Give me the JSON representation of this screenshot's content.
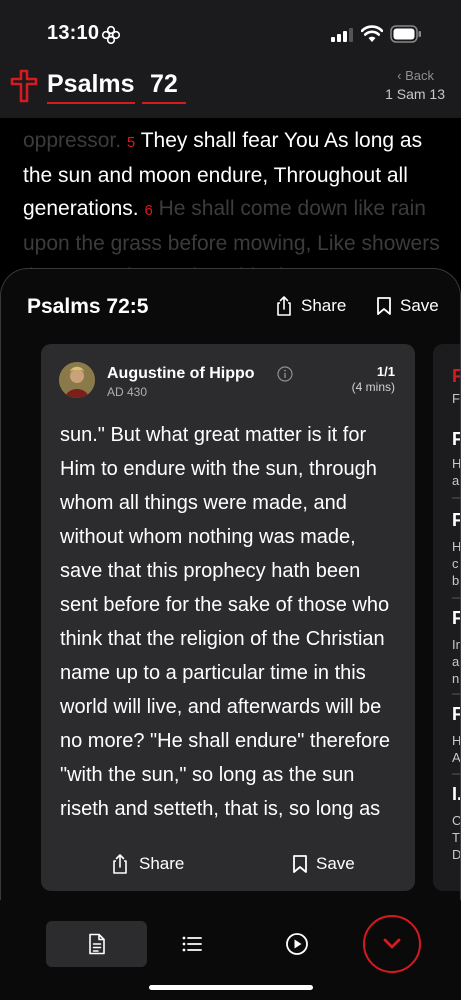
{
  "status": {
    "time": "13:10"
  },
  "header": {
    "book": "Psalms",
    "chapter": "72",
    "back_label": "Back",
    "back_ref": "1 Sam 13"
  },
  "scripture": {
    "pre": "oppressor.",
    "v5_num": "5",
    "v5_text": "They shall fear You As long as the sun and moon endure, Throughout all generations.",
    "v6_num": "6",
    "v6_text": "He shall come down like rain upon the grass before mowing, Like showers that water the earth. In his days"
  },
  "sheet": {
    "title": "Psalms 72:5",
    "share_label": "Share",
    "save_label": "Save"
  },
  "card": {
    "author": "Augustine of Hippo",
    "date": "AD 430",
    "page": "1/1",
    "read_time": "(4 mins)",
    "body": "sun.\" But what great matter is it for Him to endure with the sun, through whom all things were made, and without whom nothing was made, save that this prophecy hath been sent before for the sake of those who think that the religion of the Christian name up to a particular time in this world will live, and afterwards will be no more? \"He shall endure\" therefore \"with the sun,\" so long as the sun riseth and setteth, that is, so long as",
    "share_label": "Share",
    "save_label": "Save"
  },
  "peek_card": {
    "items": [
      {
        "big": "F",
        "small": "F"
      },
      {
        "big": "F",
        "small": "H\na"
      },
      {
        "big": "F",
        "small": "H\nc\nb"
      },
      {
        "big": "F",
        "small": "Ir\na\nn"
      },
      {
        "big": "F",
        "small": "H\nA"
      },
      {
        "big": "I.",
        "small": "C\nT\nD"
      }
    ]
  },
  "colors": {
    "accent": "#d71920",
    "card": "#2c2c2e",
    "bar": "#1b1b1d"
  },
  "toolbar": {
    "icons": [
      "notes-icon",
      "list-icon",
      "play-icon",
      "chevron-down-icon"
    ]
  }
}
